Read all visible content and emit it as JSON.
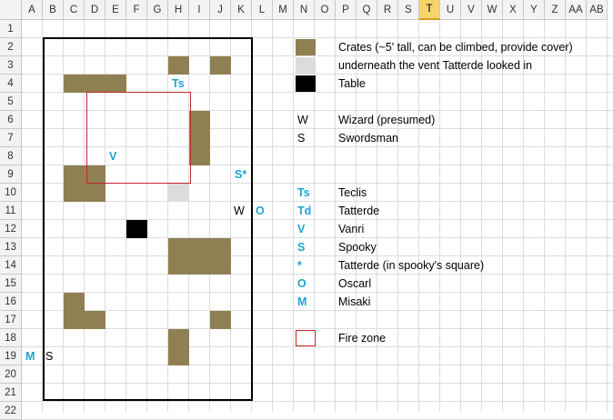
{
  "columns": [
    "A",
    "B",
    "C",
    "D",
    "E",
    "F",
    "G",
    "H",
    "I",
    "J",
    "K",
    "L",
    "M",
    "N",
    "O",
    "P",
    "Q",
    "R",
    "S",
    "T",
    "U",
    "V",
    "W",
    "X",
    "Y",
    "Z",
    "AA",
    "AB"
  ],
  "selected_column": "T",
  "rows": [
    "1",
    "2",
    "3",
    "4",
    "5",
    "6",
    "7",
    "8",
    "9",
    "10",
    "11",
    "12",
    "13",
    "14",
    "15",
    "16",
    "17",
    "18",
    "19",
    "20",
    "21",
    "22"
  ],
  "colors": {
    "crate": "#8f8053",
    "vent": "#dcdcdc",
    "table": "#000000",
    "fire_zone": "#c0282a",
    "token_blue": "#1ea2d6",
    "header_selected": "#f8d36b"
  },
  "map_cells": {
    "crates": [
      "H3",
      "J3",
      "C4",
      "D4",
      "E4",
      "I6",
      "I7",
      "I8",
      "C9",
      "D9",
      "C10",
      "D10",
      "H13",
      "I13",
      "J13",
      "H14",
      "I14",
      "J14",
      "C16",
      "C17",
      "D17",
      "J17",
      "H18",
      "H19"
    ],
    "vents": [
      "H10"
    ],
    "tables": [
      "F12"
    ],
    "fire_zone_range": "E5:H9"
  },
  "tokens": [
    {
      "cell": "H4",
      "text": "Ts",
      "color": "blue"
    },
    {
      "cell": "E8",
      "text": "V",
      "color": "blue"
    },
    {
      "cell": "K9",
      "text": "S*",
      "color": "blue"
    },
    {
      "cell": "K11",
      "text": "W",
      "color": "black"
    },
    {
      "cell": "L11",
      "text": "O",
      "color": "blue"
    },
    {
      "cell": "A19",
      "text": "M",
      "color": "blue"
    },
    {
      "cell": "B19",
      "text": "S",
      "color": "black"
    }
  ],
  "legend": [
    {
      "key": "swatch",
      "swatch": "crate",
      "label": "Crates (~5' tall, can be climbed, provide cover)"
    },
    {
      "key": "swatch",
      "swatch": "vent",
      "label": "underneath the vent Tatterde looked in"
    },
    {
      "key": "swatch",
      "swatch": "table",
      "label": "Table"
    },
    {
      "key": "text",
      "symbol": "W",
      "symbol_color": "black",
      "label": "Wizard (presumed)"
    },
    {
      "key": "text",
      "symbol": "S",
      "symbol_color": "black",
      "label": "Swordsman"
    },
    {
      "key": "text",
      "symbol": "Ts",
      "symbol_color": "blue",
      "label": "Teclis"
    },
    {
      "key": "text",
      "symbol": "Td",
      "symbol_color": "blue",
      "label": "Tatterde"
    },
    {
      "key": "text",
      "symbol": "V",
      "symbol_color": "blue",
      "label": "Vanri"
    },
    {
      "key": "text",
      "symbol": "S",
      "symbol_color": "blue",
      "label": "Spooky"
    },
    {
      "key": "text",
      "symbol": "*",
      "symbol_color": "blue",
      "label": "Tatterde (in spooky's square)"
    },
    {
      "key": "text",
      "symbol": "O",
      "symbol_color": "blue",
      "label": "Oscarl"
    },
    {
      "key": "text",
      "symbol": "M",
      "symbol_color": "blue",
      "label": "Misaki"
    },
    {
      "key": "swatch",
      "swatch": "fire_zone",
      "label": "Fire zone"
    }
  ],
  "legend_rows": [
    "2",
    "3",
    "4",
    "6",
    "7",
    "10",
    "11",
    "12",
    "13",
    "14",
    "15",
    "16",
    "18"
  ]
}
